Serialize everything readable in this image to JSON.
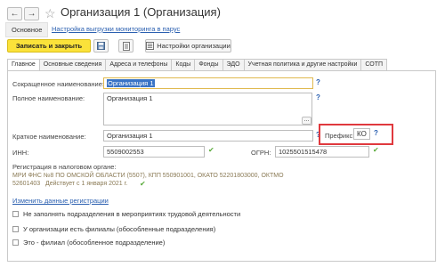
{
  "window": {
    "title": "Организация 1 (Организация)"
  },
  "subnav": {
    "main_label": "Основное",
    "export_link": "Настройка выгрузки мониторинга в парус"
  },
  "toolbar": {
    "save_close": "Записать и закрыть",
    "settings": "Настройки организации"
  },
  "tabs": [
    {
      "label": "Главное",
      "active": true
    },
    {
      "label": "Основные сведения",
      "active": false
    },
    {
      "label": "Адреса и телефоны",
      "active": false
    },
    {
      "label": "Коды",
      "active": false
    },
    {
      "label": "Фонды",
      "active": false
    },
    {
      "label": "ЭДО",
      "active": false
    },
    {
      "label": "Учетная политика и другие настройки",
      "active": false
    },
    {
      "label": "СОТП",
      "active": false
    }
  ],
  "form": {
    "short_name_label": "Сокращенное наименование:",
    "short_name_value": "Организация 1",
    "full_name_label": "Полное наименование:",
    "full_name_value": "Организация 1",
    "brief_name_label": "Краткое наименование:",
    "brief_name_value": "Организация 1",
    "prefix_label": "Префикс:",
    "prefix_value": "КО",
    "inn_label": "ИНН:",
    "inn_value": "5509002553",
    "ogrn_label": "ОГРН:",
    "ogrn_value": "1025501515478",
    "tax_label": "Регистрация в налоговом органе:",
    "tax_line1": "МРИ ФНС №8 ПО ОМСКОЙ ОБЛАСТИ (5507), КПП 550901001, ОКАТО 52201803000, ОКТМО",
    "tax_line2": "52601403",
    "tax_valid": "Действует с 1 января 2021 г.",
    "change_reg_link": "Изменить данные регистрации",
    "ellipsis": "...",
    "help": "?"
  },
  "checkboxes": [
    {
      "label": "Не заполнять подразделения в мероприятиях трудовой деятельности"
    },
    {
      "label": "У организации есть филиалы (обособленные подразделения)"
    },
    {
      "label": "Это - филиал (обособленное подразделение)"
    }
  ],
  "colors": {
    "accent_yellow": "#fbe23a",
    "highlight_red": "#e0393e",
    "link_blue": "#2a5fb0"
  }
}
